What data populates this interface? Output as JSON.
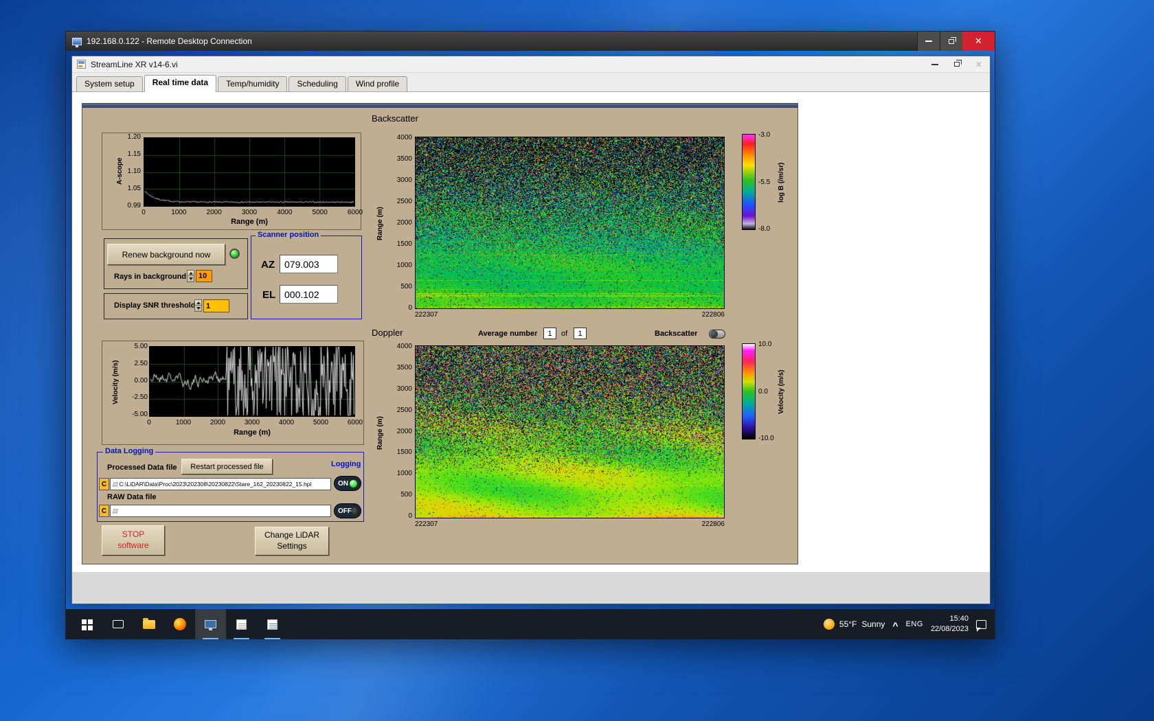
{
  "rdp_window": {
    "title": "192.168.0.122 - Remote Desktop Connection"
  },
  "app_window": {
    "title": "StreamLine XR v14-6.vi",
    "active_tab": "Real time data",
    "tabs": [
      {
        "label": "System setup"
      },
      {
        "label": "Real time data"
      },
      {
        "label": "Temp/humidity"
      },
      {
        "label": "Scheduling"
      },
      {
        "label": "Wind profile"
      }
    ]
  },
  "panel": {
    "background_controls": {
      "renew_button": "Renew background now",
      "rays_label": "Rays in background",
      "rays_value": "10",
      "snr_label": "Display SNR threshold",
      "snr_value": "1"
    },
    "scanner": {
      "title": "Scanner position",
      "az_label": "AZ",
      "az_value": "079.003",
      "el_label": "EL",
      "el_value": "000.102"
    },
    "doppler_controls": {
      "avg_label": "Average number",
      "avg_value": "1",
      "of_label": "of",
      "total_value": "1",
      "toggle_label": "Backscatter"
    },
    "data_logging": {
      "title": "Data Logging",
      "processed_label": "Processed Data file",
      "restart_button": "Restart processed file",
      "logging_label": "Logging",
      "drive_letter": "C",
      "processed_path": "C:\\LiDAR\\Data\\Proc\\2023\\202308\\20230822\\Stare_162_20230822_15.hpl",
      "processed_toggle": "ON",
      "raw_label": "RAW Data file",
      "raw_path": "",
      "raw_toggle": "OFF"
    },
    "stop_button": {
      "line1": "STOP",
      "line2": "software"
    },
    "settings_button": {
      "line1": "Change LiDAR",
      "line2": "Settings"
    }
  },
  "taskbar": {
    "weather_temp": "55°F",
    "weather_desc": "Sunny",
    "language": "ENG",
    "time": "15:40",
    "date": "22/08/2023"
  },
  "icons": {
    "close_glyph": "✕",
    "chevron_up_glyph": "^"
  },
  "chart_data": [
    {
      "id": "ascope",
      "type": "line",
      "title": "A-scope",
      "xlabel": "Range (m)",
      "ylabel": "A-scope",
      "xlim": [
        0,
        6000
      ],
      "ylim": [
        0.99,
        1.2
      ],
      "xticks": [
        "0",
        "1000",
        "2000",
        "3000",
        "4000",
        "5000",
        "6000"
      ],
      "yticks": [
        "1.20",
        "1.15",
        "1.10",
        "1.05",
        "0.99"
      ],
      "grid": true,
      "series": [
        {
          "name": "background signal",
          "summary": "flat white trace near 1.00 over full range, small bump to ~1.04 at 0 m decaying by ~400 m, ±0.002 noise"
        }
      ],
      "render_model": {
        "kind": "ascope",
        "seed": 7,
        "bump": 0.035,
        "decay": 20,
        "noise": 0.004
      }
    },
    {
      "id": "velocity_line",
      "type": "line",
      "title": "Velocity",
      "xlabel": "Range (m)",
      "ylabel": "Velocity (m/s)",
      "xlim": [
        0,
        6000
      ],
      "ylim": [
        -5,
        5
      ],
      "xticks": [
        "0",
        "1000",
        "2000",
        "3000",
        "4000",
        "5000",
        "6000"
      ],
      "yticks": [
        "5.00",
        "2.50",
        "0.00",
        "-2.50",
        "-5.00"
      ],
      "grid": true,
      "series": [
        {
          "name": "radial velocity",
          "summary": "coherent ±1 m/s signal out to ~2300 m, saturated ±5 m/s random noise spikes beyond"
        }
      ],
      "render_model": {
        "kind": "velocity",
        "seed": 21,
        "calm_until": 0.37,
        "wild_amp": 14
      }
    },
    {
      "id": "backscatter_map",
      "type": "heatmap",
      "title": "Backscatter",
      "ylabel": "Range (m)",
      "ylim": [
        0,
        4000
      ],
      "yticks": [
        "4000",
        "3500",
        "3000",
        "2500",
        "2000",
        "1500",
        "1000",
        "500",
        "0"
      ],
      "xticks": [
        "222307",
        "222806"
      ],
      "colorbar": {
        "label": "log B (/m/sr)",
        "ticks": [
          "-3.0",
          "-5.5",
          "-8.0"
        ],
        "range": [
          -3,
          -8
        ]
      },
      "summary": "Time-height attenuated backscatter: smooth green (~-5.5) in lowest ~1500 m grading to speckled multicolour noise with black dropouts above 2000 m",
      "render_model": {
        "kind": "heat",
        "seed": 99,
        "base0": 0.55,
        "baseSlope": -0.22,
        "jitter": 0.1,
        "wave": 0.03,
        "wave2": 0.03,
        "streakP": 0.1,
        "streakAmp": 0.22,
        "npKnee": 0.15,
        "npSlope": 1.25,
        "npMin": 0.05,
        "npMax": 0.92,
        "bpKnee": 0.28,
        "bpSlope": 0.8,
        "bpMin": 0.02,
        "bpMax": 0.5,
        "groundBoost": 0.06,
        "stops": [
          [
            0,
            10,
            0,
            40
          ],
          [
            0.08,
            70,
            0,
            160
          ],
          [
            0.2,
            0,
            60,
            220
          ],
          [
            0.33,
            0,
            160,
            180
          ],
          [
            0.45,
            0,
            185,
            90
          ],
          [
            0.55,
            30,
            205,
            40
          ],
          [
            0.66,
            140,
            220,
            0
          ],
          [
            0.78,
            250,
            210,
            0
          ],
          [
            0.88,
            255,
            90,
            0
          ],
          [
            1,
            255,
            0,
            180
          ]
        ]
      }
    },
    {
      "id": "doppler_map",
      "type": "heatmap",
      "title": "Doppler",
      "ylabel": "Range (m)",
      "ylim": [
        0,
        4000
      ],
      "yticks": [
        "4000",
        "3500",
        "3000",
        "2500",
        "2000",
        "1500",
        "1000",
        "500",
        "0"
      ],
      "xticks": [
        "222307",
        "222806"
      ],
      "colorbar": {
        "label": "Velocity (m/s)",
        "ticks": [
          "10.0",
          "0.0",
          "-10.0"
        ],
        "range": [
          10,
          -10
        ]
      },
      "summary": "Time-height radial velocity: coherent light-green/yellow (0 to +2 m/s) below ~1500 m, random magenta/green/black speckle above",
      "render_model": {
        "kind": "heat",
        "seed": 1234,
        "base0": 0.58,
        "baseSlope": -0.08,
        "jitter": 0.07,
        "wave": 0.05,
        "wave2": 0.04,
        "streakP": 0.06,
        "streakAmp": 0.1,
        "npKnee": 0.22,
        "npSlope": 1.7,
        "npMin": 0.04,
        "npMax": 0.95,
        "bpKnee": 0.22,
        "bpSlope": 0.6,
        "bpMin": 0.01,
        "bpMax": 0.35,
        "groundBoost": 0.06,
        "stops": [
          [
            0,
            5,
            5,
            10
          ],
          [
            0.06,
            40,
            0,
            120
          ],
          [
            0.15,
            30,
            60,
            220
          ],
          [
            0.28,
            0,
            150,
            200
          ],
          [
            0.4,
            0,
            190,
            80
          ],
          [
            0.5,
            60,
            220,
            30
          ],
          [
            0.6,
            170,
            235,
            0
          ],
          [
            0.7,
            250,
            200,
            0
          ],
          [
            0.78,
            255,
            110,
            0
          ],
          [
            0.86,
            255,
            30,
            60
          ],
          [
            0.94,
            255,
            0,
            180
          ],
          [
            1,
            255,
            150,
            255
          ]
        ]
      }
    }
  ]
}
